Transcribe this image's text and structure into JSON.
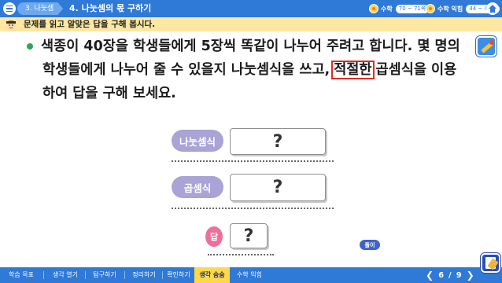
{
  "topbar": {
    "unit": "3. 나눗셈",
    "lesson": "4. 나눗셈의 몫 구하기",
    "textbook_label": "수학",
    "textbook_pages": "70 ~ 71쪽",
    "workbook_label": "수학 익힘",
    "workbook_pages": "44 ~ 45쪽"
  },
  "instruction": "문제를 읽고 알맞은 답을 구해 봅시다.",
  "question": {
    "line1": "색종이 40장을 학생들에게 5장씩 똑같이 나누어 주려고 합니다. 몇 명의",
    "line2_before": "학생들에게 나누어 줄 수 있을지 나눗셈식을 쓰고,",
    "line2_highlight": "적절한",
    "line2_after": "곱셈식을 이용",
    "line3": "하여 답을 구해 보세요."
  },
  "answers": {
    "division_label": "나눗셈식",
    "division_value": "?",
    "multiplication_label": "곱셈식",
    "multiplication_value": "?",
    "answer_label": "답",
    "answer_value": "?"
  },
  "solve_button": "풀이",
  "bottom_nav": {
    "items": [
      "학습 목표",
      "생각 열기",
      "탐구하기",
      "정리하기",
      "확인하기",
      "생각 숨숨",
      "수학 익힘"
    ],
    "active_index": 5
  },
  "pager": {
    "current": "6",
    "sep": "/",
    "total": "9"
  }
}
